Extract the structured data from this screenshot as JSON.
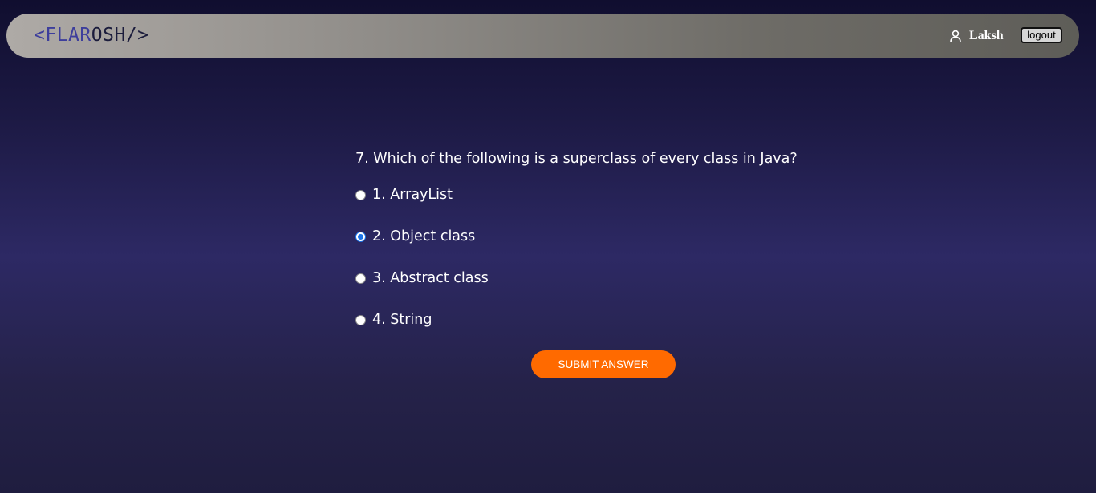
{
  "header": {
    "logo": {
      "open_bracket": "<",
      "name_part1": "FLAR",
      "name_part2": "OSH",
      "close_bracket": "/>"
    },
    "user": {
      "icon": "user-icon",
      "name": "Laksh"
    },
    "logout_label": "logout"
  },
  "quiz": {
    "question": "7. Which of the following is a superclass of every class in Java?",
    "options": [
      {
        "label": "1. ArrayList",
        "selected": false
      },
      {
        "label": "2. Object class",
        "selected": true
      },
      {
        "label": "3. Abstract class",
        "selected": false
      },
      {
        "label": "4. String",
        "selected": false
      }
    ],
    "submit_label": "SUBMIT ANSWER"
  },
  "colors": {
    "accent": "#ff6a00",
    "logo_blue": "#3d3e9c",
    "logo_dark": "#1b1c3c",
    "radio_selected": "#1a73e8"
  }
}
